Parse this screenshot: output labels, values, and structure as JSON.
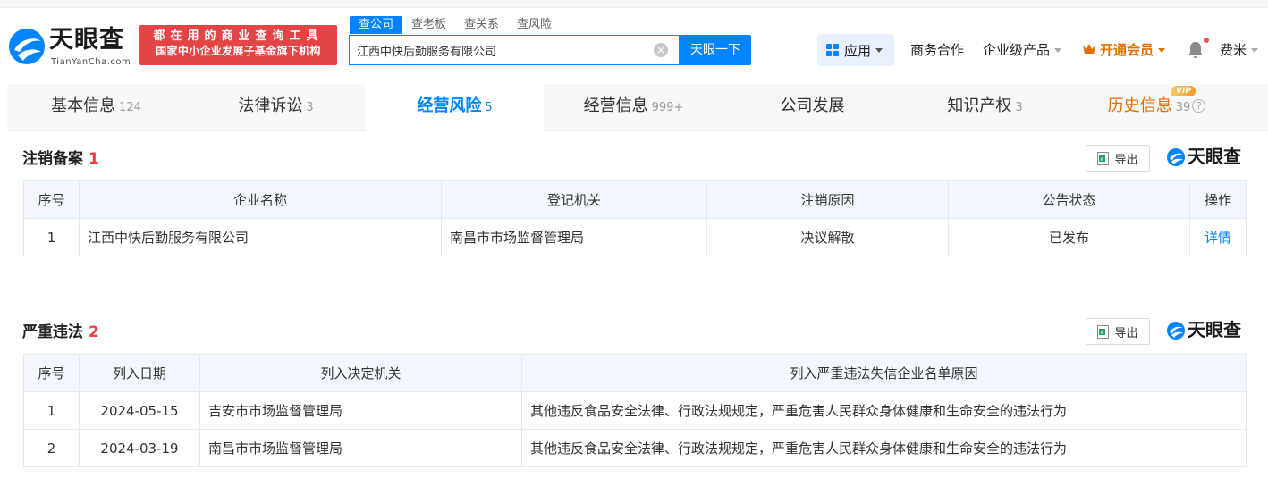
{
  "brand": {
    "name_cn": "天眼查",
    "domain": "TianYanCha.com",
    "slogan_line1": "都在用的商业查询工具",
    "slogan_line2": "国家中小企业发展子基金旗下机构",
    "blue": "#0084ff",
    "red": "#e34546"
  },
  "search": {
    "tabs": [
      {
        "label": "查公司",
        "active": true
      },
      {
        "label": "查老板",
        "active": false
      },
      {
        "label": "查关系",
        "active": false
      },
      {
        "label": "查风险",
        "active": false
      }
    ],
    "value": "江西中快后勤服务有限公司",
    "clear_icon": "close-circle-icon",
    "button": "天眼一下"
  },
  "nav": {
    "apps": "应用",
    "business": "商务合作",
    "enterprise": "企业级产品",
    "vip": "开通会员",
    "user": "费米"
  },
  "tabs": [
    {
      "label": "基本信息",
      "count": "124"
    },
    {
      "label": "法律诉讼",
      "count": "3"
    },
    {
      "label": "经营风险",
      "count": "5",
      "active": true
    },
    {
      "label": "经营信息",
      "count": "999+"
    },
    {
      "label": "公司发展",
      "count": ""
    },
    {
      "label": "知识产权",
      "count": "3"
    },
    {
      "label": "历史信息",
      "count": "39",
      "badge": "VIP"
    }
  ],
  "cancellation": {
    "title": "注销备案",
    "count": "1",
    "export": "导出",
    "brand": "天眼查",
    "headers": [
      "序号",
      "企业名称",
      "登记机关",
      "注销原因",
      "公告状态",
      "操作"
    ],
    "rows": [
      {
        "index": "1",
        "company": "江西中快后勤服务有限公司",
        "authority": "南昌市市场监督管理局",
        "reason": "决议解散",
        "status": "已发布",
        "action": "详情"
      }
    ]
  },
  "violation": {
    "title": "严重违法",
    "count": "2",
    "export": "导出",
    "brand": "天眼查",
    "headers": [
      "序号",
      "列入日期",
      "列入决定机关",
      "列入严重违法失信企业名单原因"
    ],
    "rows": [
      {
        "index": "1",
        "date": "2024-05-15",
        "authority": "吉安市市场监督管理局",
        "reason": "其他违反食品安全法律、行政法规规定，严重危害人民群众身体健康和生命安全的违法行为"
      },
      {
        "index": "2",
        "date": "2024-03-19",
        "authority": "南昌市市场监督管理局",
        "reason": "其他违反食品安全法律、行政法规规定，严重危害人民群众身体健康和生命安全的违法行为"
      }
    ]
  }
}
